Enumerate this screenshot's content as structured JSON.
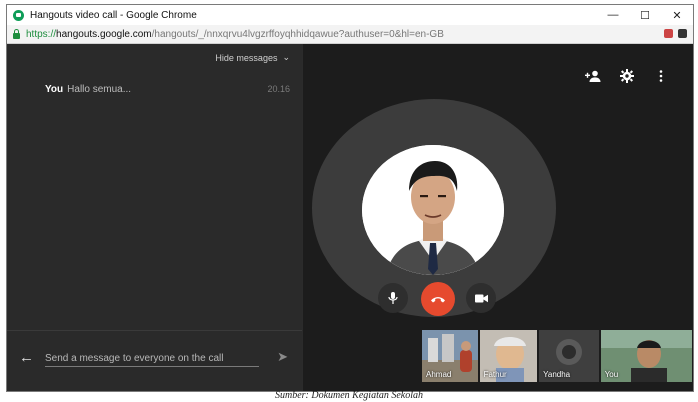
{
  "window": {
    "title": "Hangouts video call - Google Chrome",
    "controls": {
      "minimize": "—",
      "maximize": "☐",
      "close": "✕"
    }
  },
  "addressbar": {
    "scheme": "https://",
    "host": "hangouts.google.com",
    "path": "/hangouts/_/nnxqrvu4lvgzrffoyqhhidqawue?authuser=0&hl=en-GB"
  },
  "chat": {
    "hide_label": "Hide messages",
    "messages": [
      {
        "sender": "You",
        "text": "Hallo semua...",
        "time": "20.16"
      }
    ],
    "input_placeholder": "Send a message to everyone on the call"
  },
  "video": {
    "top_icons": [
      "add-person-icon",
      "settings-gear-icon",
      "more-vert-icon"
    ],
    "controls": [
      "mic-icon",
      "end-call-icon",
      "camera-icon"
    ],
    "participants": [
      {
        "label": "Ahmad",
        "bg": "#6f8aa8"
      },
      {
        "label": "Fathur",
        "bg": "#b9b2a8"
      },
      {
        "label": "Yandha",
        "bg": "#4a4a4a"
      },
      {
        "label": "You",
        "bg": "#5f7f62"
      }
    ]
  },
  "colors": {
    "end_call": "#e64a2e",
    "url_scheme": "#1e8e3e",
    "chat_bg": "#2a2a2a",
    "video_bg": "#1c1c1c"
  },
  "caption": "Sumber: Dokumen Kegiatan Sekolah"
}
